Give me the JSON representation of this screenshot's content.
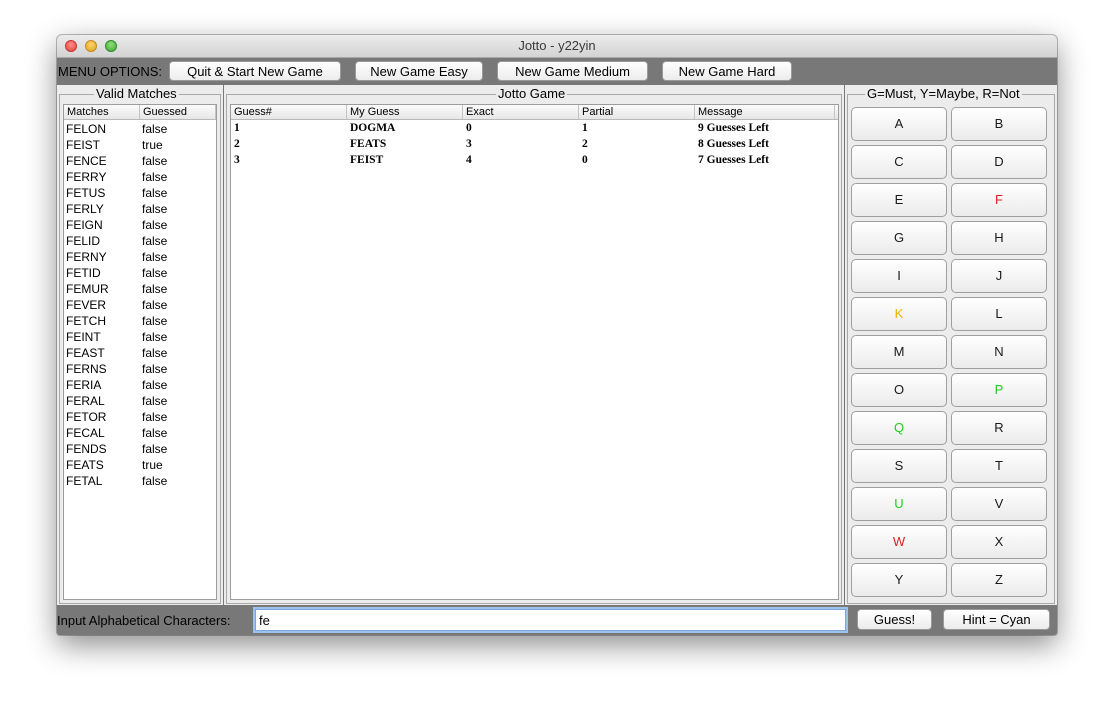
{
  "window": {
    "title": "Jotto - y22yin"
  },
  "menu": {
    "label": "MENU OPTIONS:",
    "buttons": [
      "Quit & Start New Game",
      "New Game Easy",
      "New Game Medium",
      "New Game Hard"
    ]
  },
  "valid_matches": {
    "title": "Valid Matches",
    "headers": [
      "Matches",
      "Guessed"
    ],
    "rows": [
      [
        "FELON",
        "false"
      ],
      [
        "FEIST",
        "true"
      ],
      [
        "FENCE",
        "false"
      ],
      [
        "FERRY",
        "false"
      ],
      [
        "FETUS",
        "false"
      ],
      [
        "FERLY",
        "false"
      ],
      [
        "FEIGN",
        "false"
      ],
      [
        "FELID",
        "false"
      ],
      [
        "FERNY",
        "false"
      ],
      [
        "FETID",
        "false"
      ],
      [
        "FEMUR",
        "false"
      ],
      [
        "FEVER",
        "false"
      ],
      [
        "FETCH",
        "false"
      ],
      [
        "FEINT",
        "false"
      ],
      [
        "FEAST",
        "false"
      ],
      [
        "FERNS",
        "false"
      ],
      [
        "FERIA",
        "false"
      ],
      [
        "FERAL",
        "false"
      ],
      [
        "FETOR",
        "false"
      ],
      [
        "FECAL",
        "false"
      ],
      [
        "FENDS",
        "false"
      ],
      [
        "FEATS",
        "true"
      ],
      [
        "FETAL",
        "false"
      ]
    ]
  },
  "game": {
    "title": "Jotto Game",
    "headers": [
      "Guess#",
      "My Guess",
      "Exact",
      "Partial",
      "Message"
    ],
    "rows": [
      [
        "1",
        "DOGMA",
        "0",
        "1",
        "9 Guesses Left"
      ],
      [
        "2",
        "FEATS",
        "3",
        "2",
        "8 Guesses Left"
      ],
      [
        "3",
        "FEIST",
        "4",
        "0",
        "7 Guesses Left"
      ]
    ]
  },
  "letters": {
    "title": "G=Must, Y=Maybe, R=Not",
    "colors": {
      "default": "#1a1a1a",
      "green": "#22cc22",
      "yellow": "#f0b400",
      "red": "#e02020"
    },
    "keys": [
      {
        "letter": "A",
        "status": "default"
      },
      {
        "letter": "B",
        "status": "default"
      },
      {
        "letter": "C",
        "status": "default"
      },
      {
        "letter": "D",
        "status": "default"
      },
      {
        "letter": "E",
        "status": "default"
      },
      {
        "letter": "F",
        "status": "red"
      },
      {
        "letter": "G",
        "status": "default"
      },
      {
        "letter": "H",
        "status": "default"
      },
      {
        "letter": "I",
        "status": "default"
      },
      {
        "letter": "J",
        "status": "default"
      },
      {
        "letter": "K",
        "status": "yellow"
      },
      {
        "letter": "L",
        "status": "default"
      },
      {
        "letter": "M",
        "status": "default"
      },
      {
        "letter": "N",
        "status": "default"
      },
      {
        "letter": "O",
        "status": "default"
      },
      {
        "letter": "P",
        "status": "green"
      },
      {
        "letter": "Q",
        "status": "green"
      },
      {
        "letter": "R",
        "status": "default"
      },
      {
        "letter": "S",
        "status": "default"
      },
      {
        "letter": "T",
        "status": "default"
      },
      {
        "letter": "U",
        "status": "green"
      },
      {
        "letter": "V",
        "status": "default"
      },
      {
        "letter": "W",
        "status": "red"
      },
      {
        "letter": "X",
        "status": "default"
      },
      {
        "letter": "Y",
        "status": "default"
      },
      {
        "letter": "Z",
        "status": "default"
      }
    ]
  },
  "input": {
    "label": "Input Alphabetical Characters:",
    "value": "fe",
    "guess_button": "Guess!",
    "hint_button": "Hint = Cyan"
  }
}
